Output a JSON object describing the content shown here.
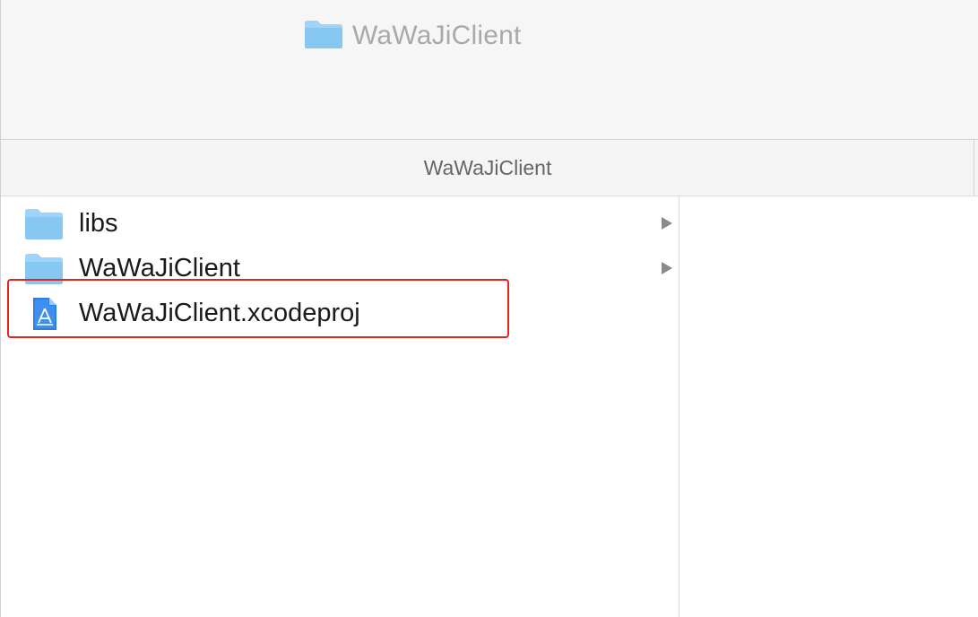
{
  "window": {
    "title": "WaWaJiClient",
    "title_icon": "folder-icon"
  },
  "column_header": {
    "title": "WaWaJiClient"
  },
  "files": [
    {
      "name": "libs",
      "icon": "folder-icon",
      "expandable": true
    },
    {
      "name": "WaWaJiClient",
      "icon": "folder-icon",
      "expandable": true
    },
    {
      "name": "WaWaJiClient.xcodeproj",
      "icon": "xcodeproj-icon",
      "expandable": false
    }
  ],
  "colors": {
    "folder": "#8ecdf4",
    "highlight": "#e8231d",
    "title_text": "#a9a9a9"
  }
}
